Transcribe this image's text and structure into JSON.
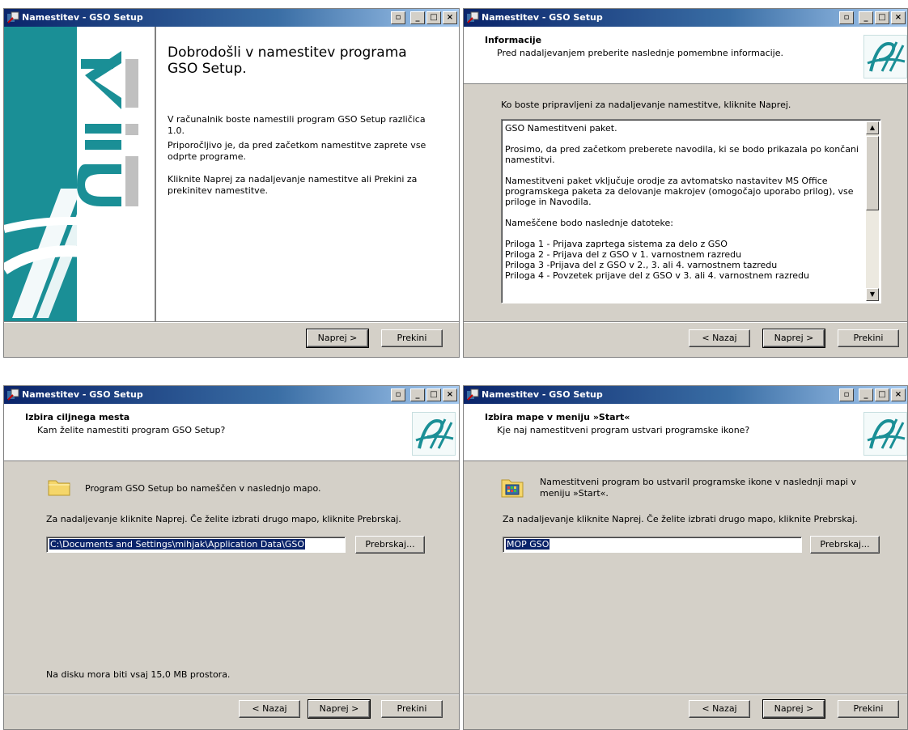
{
  "common": {
    "title": "Namestitev - GSO Setup",
    "btn_back": "< Nazaj",
    "btn_next": "Naprej >",
    "btn_cancel": "Prekini",
    "btn_browse": "Prebrskaj...",
    "title_buttons": [
      "restore",
      "minimize",
      "maximize",
      "close"
    ]
  },
  "welcome": {
    "heading": "Dobrodošli v namestitev programa GSO Setup.",
    "para1": "V računalnik boste namestili program GSO Setup različica 1.0.",
    "para2": "Priporočljivo je, da pred začetkom namestitve zaprete vse odprte programe.",
    "para3": "Kliknite Naprej za nadaljevanje namestitve ali Prekini za prekinitev namestitve.",
    "banner_text": "BiA"
  },
  "info": {
    "title": "Informacije",
    "subtitle": "Pred nadaljevanjem preberite naslednje pomembne informacije.",
    "instruction": "Ko boste pripravljeni za nadaljevanje namestitve, kliknite Naprej.",
    "memo": [
      "GSO Namestitveni paket.",
      "Prosimo, da pred začetkom preberete navodila, ki se bodo prikazala po končani namestitvi.",
      "Namestitveni paket vključuje orodje za avtomatsko nastavitev MS Office programskega paketa za delovanje makrojev (omogočajo uporabo prilog), vse priloge in Navodila.",
      "Nameščene bodo naslednje datoteke:",
      "Priloga 1 - Prijava zaprtega sistema za delo z GSO\nPriloga 2 - Prijava del z GSO v 1. varnostnem razredu\nPriloga 3  -Prijava del z GSO v 2., 3. ali 4. varnostnem tazredu\nPriloga 4 - Povzetek prijave del z GSO v 3. ali 4. varnostnem razredu"
    ]
  },
  "dest": {
    "title": "Izbira ciljnega mesta",
    "subtitle": "Kam želite namestiti program GSO Setup?",
    "line1": "Program GSO Setup bo nameščen v naslednjo mapo.",
    "line2": "Za nadaljevanje kliknite Naprej. Če želite izbrati drugo mapo, kliknite Prebrskaj.",
    "path_value": "C:\\Documents and Settings\\mihjak\\Application Data\\GSO",
    "disk_space": "Na disku mora biti vsaj 15,0 MB prostora."
  },
  "startmenu": {
    "title": "Izbira mape v meniju »Start«",
    "subtitle": "Kje naj namestitveni program ustvari programske ikone?",
    "line1": "Namestitveni program bo ustvaril programske ikone v naslednji mapi v meniju »Start«.",
    "line2": "Za nadaljevanje kliknite Naprej. Če želite izbrati drugo mapo, kliknite Prebrskaj.",
    "folder_value": "MOP GSO"
  },
  "colors": {
    "titlebar_start": "#0a246a",
    "titlebar_end": "#a6caf0",
    "banner_teal": "#1a8f96",
    "face": "#d4d0c8"
  }
}
